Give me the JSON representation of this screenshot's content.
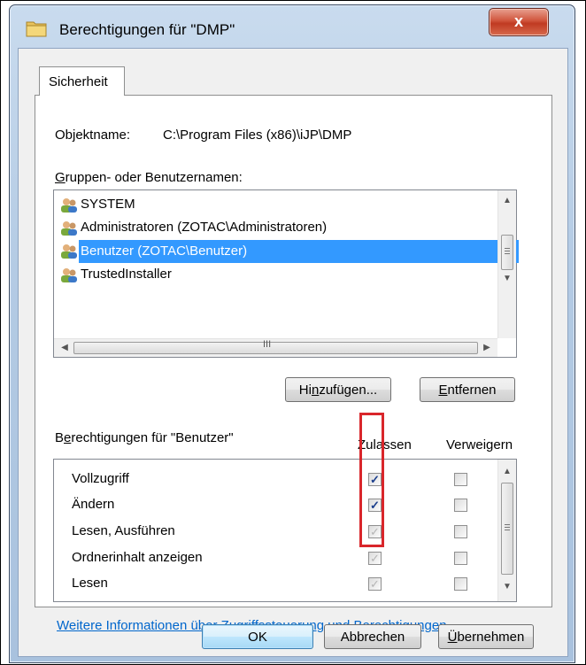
{
  "window": {
    "title": "Berechtigungen für \"DMP\"",
    "close_label": "x"
  },
  "tabs": [
    {
      "label": "Sicherheit"
    }
  ],
  "object": {
    "label": "Objektname:",
    "value": "C:\\Program Files (x86)\\iJP\\DMP"
  },
  "groups": {
    "label_prefix": "",
    "label_u": "G",
    "label_rest": "ruppen- oder Benutzernamen:",
    "items": [
      {
        "name": "SYSTEM",
        "selected": false
      },
      {
        "name": "Administratoren (ZOTAC\\Administratoren)",
        "selected": false
      },
      {
        "name": "Benutzer (ZOTAC\\Benutzer)",
        "selected": true
      },
      {
        "name": "TrustedInstaller",
        "selected": false
      }
    ],
    "hscroll_grip": "III"
  },
  "buttons": {
    "add_prefix": "Hi",
    "add_u": "n",
    "add_rest": "zufügen...",
    "remove_u": "E",
    "remove_rest": "ntfernen",
    "ok": "OK",
    "cancel": "Abbrechen",
    "apply_u": "Ü",
    "apply_rest": "bernehmen"
  },
  "permissions": {
    "label_prefix": "B",
    "label_u": "e",
    "label_rest": "rechtigungen für \"Benutzer\"",
    "allow_header": "Zulassen",
    "deny_header": "Verweigern",
    "rows": [
      {
        "name": "Vollzugriff",
        "allow": "checked",
        "deny": "none"
      },
      {
        "name": "Ändern",
        "allow": "checked",
        "deny": "none"
      },
      {
        "name": "Lesen, Ausführen",
        "allow": "grey",
        "deny": "none"
      },
      {
        "name": "Ordnerinhalt anzeigen",
        "allow": "grey",
        "deny": "none"
      },
      {
        "name": "Lesen",
        "allow": "grey",
        "deny": "none"
      }
    ]
  },
  "help_link": "Weitere Informationen über Zugriffssteuerung und Berechtigungen",
  "colors": {
    "selection": "#3399ff",
    "highlight_box": "#d9262b",
    "link": "#0066cc"
  }
}
